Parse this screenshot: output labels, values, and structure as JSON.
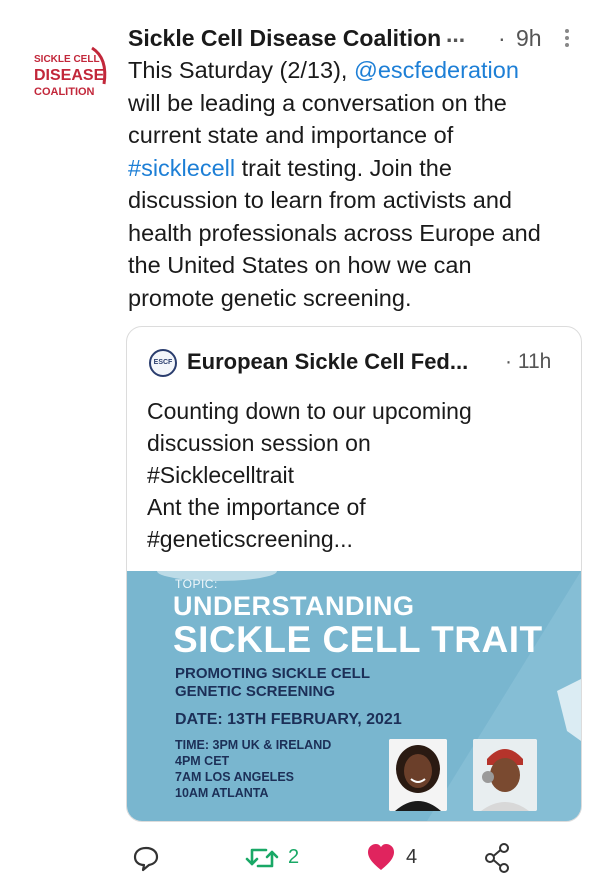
{
  "tweet": {
    "avatar_text": [
      "SICKLE CELL",
      "DISEASE",
      "COALITION"
    ],
    "author": "Sickle Cell Disease Coalition",
    "author_ellipsis": "...",
    "dot": "·",
    "time": "9h",
    "body": {
      "l1_a": "This Saturday (2/13), ",
      "l1_mention": "@escfederation",
      "l2": "will be leading a conversation on the",
      "l3": "current state and importance of",
      "l4_hashtag": "#sicklecell",
      "l4_b": " trait testing. Join the",
      "l5": "discussion to learn from activists and",
      "l6": "health professionals across Europe and",
      "l7": "the United States on how we can",
      "l8": "promote genetic screening."
    },
    "icons": {
      "more": "more-vertical-icon"
    }
  },
  "quoted": {
    "logo_text": "ESCF",
    "author": "European Sickle Cell Fed...",
    "dot": "·",
    "time": "11h",
    "lines": [
      "Counting down to our upcoming",
      "discussion session on",
      "#Sicklecelltrait",
      "Ant the importance of",
      "#geneticscreening..."
    ],
    "banner": {
      "topic": "TOPIC:",
      "heading1": "UNDERSTANDING",
      "heading2": "SICKLE CELL TRAIT",
      "sub1": "PROMOTING SICKLE CELL",
      "sub2": "GENETIC SCREENING",
      "date": "DATE: 13TH FEBRUARY, 2021",
      "time1": "TIME: 3PM UK & IRELAND",
      "time2": "4PM  CET",
      "time3": "7AM  LOS ANGELES",
      "time4": "10AM ATLANTA",
      "background": "#79b6cf"
    }
  },
  "actions": {
    "reply_icon": "reply-icon",
    "retweet_icon": "retweet-icon",
    "retweet_count": "2",
    "like_icon": "heart-icon",
    "like_count": "4",
    "share_icon": "share-icon",
    "colors": {
      "retweet": "#19a866",
      "like": "#e0245e",
      "link": "#1d7fd6"
    }
  }
}
